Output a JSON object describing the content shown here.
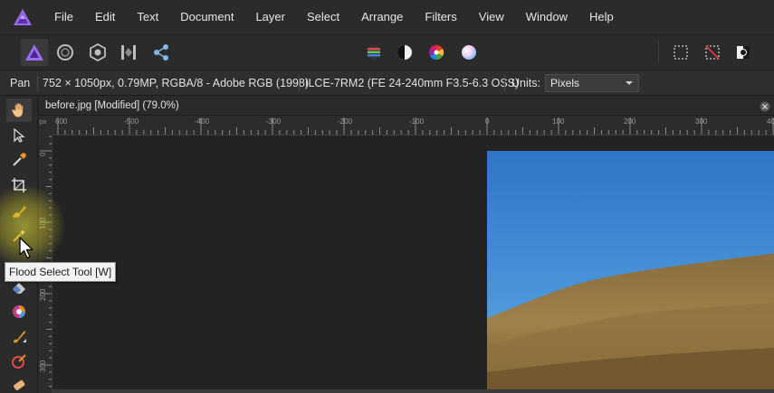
{
  "menu": {
    "items": [
      "File",
      "Edit",
      "Text",
      "Document",
      "Layer",
      "Select",
      "Arrange",
      "Filters",
      "View",
      "Window",
      "Help"
    ]
  },
  "toolbar": {
    "personas": [
      "photo-persona-icon",
      "liquify-persona-icon",
      "develop-persona-icon",
      "tone-mapping-persona-icon",
      "export-persona-icon"
    ],
    "adjust": [
      "levels-icon",
      "auto-contrast-icon",
      "auto-colour-icon",
      "white-balance-icon"
    ],
    "selection": [
      "marquee-select-icon",
      "deselect-icon",
      "invert-selection-icon"
    ]
  },
  "context": {
    "tool_name": "Pan",
    "doc_info": "752 × 1050px, 0.79MP, RGBA/8 - Adobe RGB (1998)",
    "camera_info": "ILCE-7RM2 (FE 24-240mm F3.5-6.3 OSS)",
    "units_label": "Units:",
    "units_value": "Pixels"
  },
  "document": {
    "tab_title": "before.jpg [Modified] (79.0%)"
  },
  "ruler": {
    "corner_unit": "px",
    "h_labels": [
      "600",
      "-500",
      "-400",
      "-300",
      "-200",
      "-100",
      "0",
      "100",
      "200",
      "300",
      "400"
    ],
    "v_labels": [
      "0",
      "100",
      "200",
      "300"
    ]
  },
  "tooltip": {
    "text": "Flood Select Tool [W]"
  },
  "colors": {
    "accent": "#8b5cf6",
    "panel": "#2b2b2b",
    "canvas": "#232323"
  }
}
